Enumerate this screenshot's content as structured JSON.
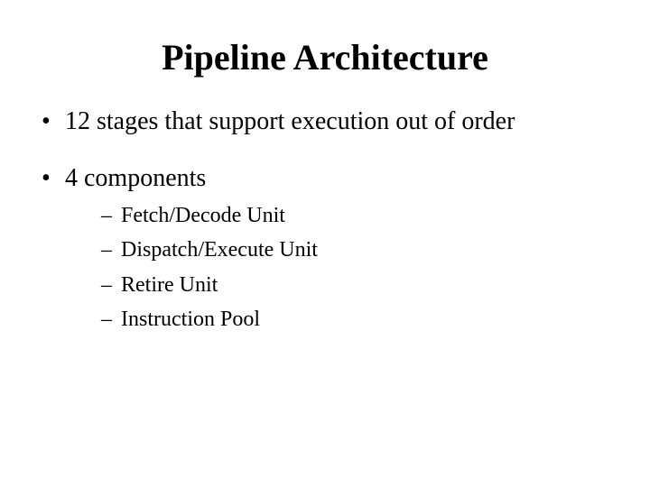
{
  "title": "Pipeline Architecture",
  "bullets": [
    {
      "text": "12 stages that support execution out of order"
    },
    {
      "text": "4 components",
      "subs": [
        "Fetch/Decode Unit",
        "Dispatch/Execute Unit",
        "Retire Unit",
        "Instruction Pool"
      ]
    }
  ]
}
